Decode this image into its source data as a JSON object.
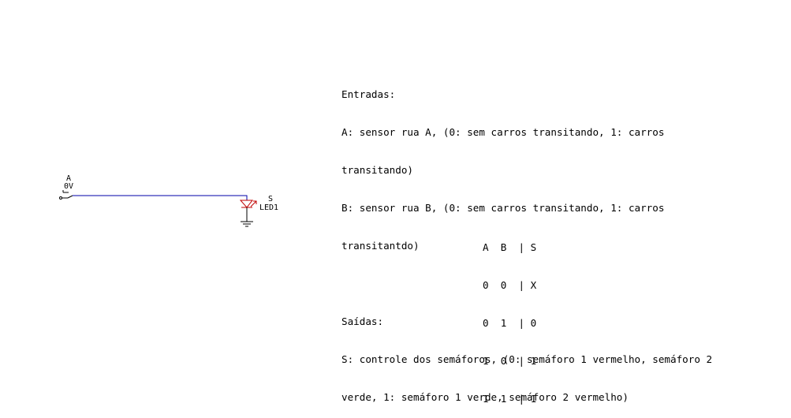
{
  "circuit": {
    "switch": {
      "name": "A",
      "value": "0V"
    },
    "led": {
      "name": "S",
      "ref": "LED1"
    },
    "colors": {
      "wire": "#0000a8",
      "led": "#c00000",
      "component": "#000000"
    }
  },
  "spec": {
    "lines": [
      "Entradas:",
      "A: sensor rua A, (0: sem carros transitando, 1: carros",
      "transitando)",
      "B: sensor rua B, (0: sem carros transitando, 1: carros",
      "transitantdo)",
      "",
      "Saídas:",
      "S: controle dos semáforos, (0: semáforo 1 vermelho, semáforo 2",
      "verde, 1: semáforo 1 verde, semáforo 2 vermelho)"
    ]
  },
  "truth_table": {
    "header": "A  B  | S",
    "rows": [
      "0  0  | X",
      "0  1  | 0",
      "1  0  | 1",
      "1  1  | 1"
    ]
  }
}
